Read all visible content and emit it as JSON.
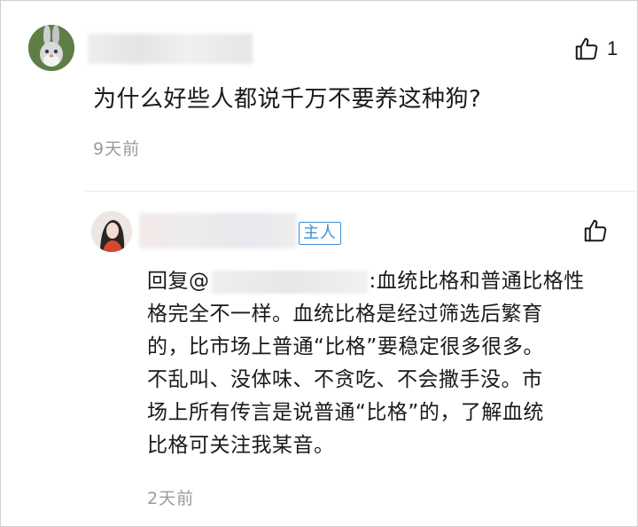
{
  "comment": {
    "like_count": "1",
    "text": "为什么好些人都说千万不要养这种狗?",
    "time": "9天前"
  },
  "reply": {
    "badge": "主人",
    "prefix": "回复@",
    "lines": [
      ":血统比格和普通比格性",
      "格完全不一样。血统比格是经过筛选后繁育",
      "的，比市场上普通“比格”要稳定很多很多。",
      "不乱叫、没体味、不贪吃、不会撒手没。市",
      "场上所有传言是说普通“比格”的，了解血统",
      "比格可关注我某音。"
    ],
    "time": "2天前"
  },
  "colors": {
    "badge": "#3a8fd9",
    "time_text": "#9a9a9a",
    "body_text": "#1a1a1a"
  },
  "icons": {
    "like": "thumbs-up-icon"
  }
}
